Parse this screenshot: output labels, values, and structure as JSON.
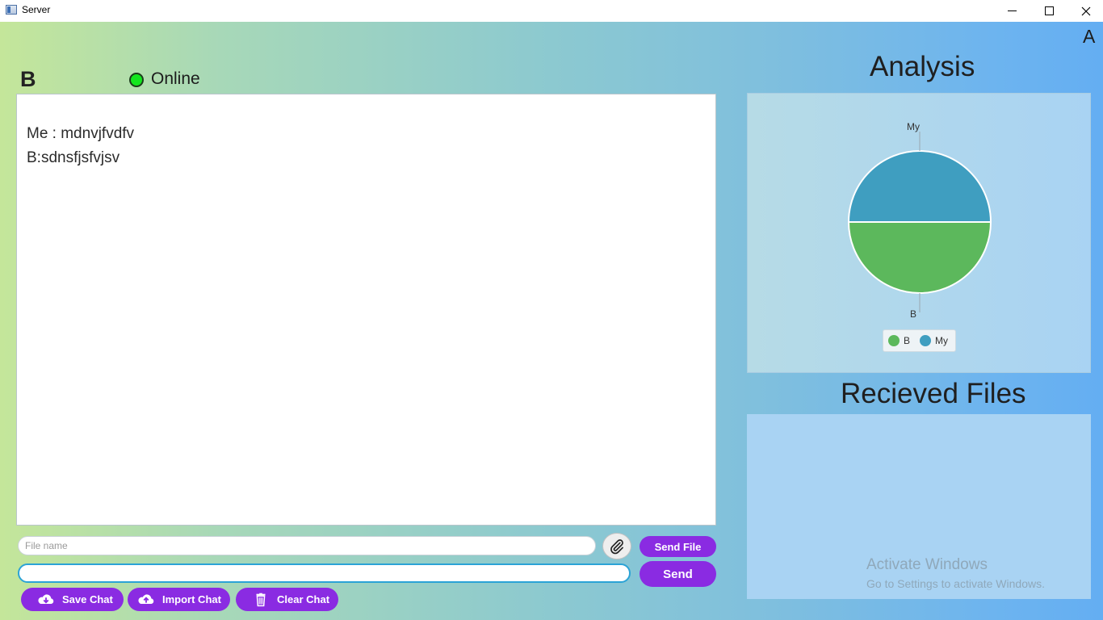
{
  "window": {
    "title": "Server",
    "corner_label": "A"
  },
  "chat": {
    "peer_name": "B",
    "status": "Online",
    "status_color": "#13e61e",
    "messages": [
      "Me : mdnvjfvdfv",
      "B:sdnsfjsfvjsv"
    ]
  },
  "file_input": {
    "placeholder": "File name",
    "value": ""
  },
  "message_input": {
    "value": ""
  },
  "buttons": {
    "send_file": "Send File",
    "send": "Send",
    "save_chat": "Save Chat",
    "import_chat": "Import Chat",
    "clear_chat": "Clear Chat",
    "accent_color": "#8a2be2"
  },
  "analysis": {
    "title": "Analysis"
  },
  "chart_data": {
    "type": "pie",
    "slices": [
      {
        "label": "My",
        "value": 50,
        "color": "#3f9ec0"
      },
      {
        "label": "B",
        "value": 50,
        "color": "#5cb85c"
      }
    ],
    "legend": [
      "B",
      "My"
    ],
    "legend_position": "bottom"
  },
  "files": {
    "title": "Recieved Files",
    "items": []
  },
  "watermark": {
    "line1": "Activate Windows",
    "line2": "Go to Settings to activate Windows."
  }
}
